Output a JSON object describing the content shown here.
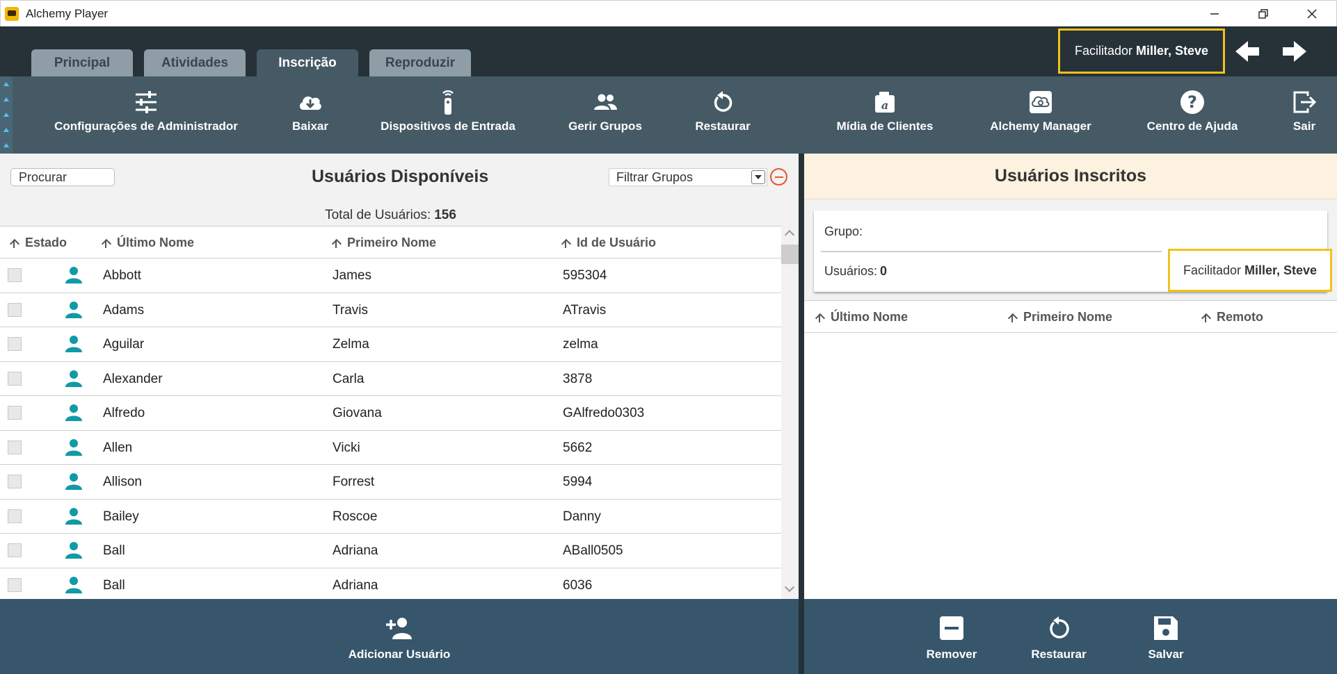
{
  "window": {
    "title": "Alchemy Player",
    "minimize_label": "—",
    "restore_label": "❐",
    "close_label": "✕"
  },
  "tabs": [
    {
      "label": "Principal",
      "active": false
    },
    {
      "label": "Atividades",
      "active": false
    },
    {
      "label": "Inscrição",
      "active": true
    },
    {
      "label": "Reproduzir",
      "active": false
    }
  ],
  "facilitator": {
    "label": "Facilitador",
    "name": "Miller, Steve"
  },
  "toolbar": [
    {
      "label": "Configurações de Administrador",
      "icon": "sliders-icon"
    },
    {
      "label": "Baixar",
      "icon": "cloud-download-icon"
    },
    {
      "label": "Dispositivos de Entrada",
      "icon": "remote-control-icon"
    },
    {
      "label": "Gerir Grupos",
      "icon": "people-icon"
    },
    {
      "label": "Restaurar",
      "icon": "restore-icon"
    },
    {
      "label": "Mídia de Clientes",
      "icon": "media-icon"
    },
    {
      "label": "Alchemy Manager",
      "icon": "cloud-sync-icon"
    },
    {
      "label": "Centro de Ajuda",
      "icon": "help-icon"
    },
    {
      "label": "Sair",
      "icon": "exit-icon"
    }
  ],
  "left": {
    "search_placeholder": "Procurar",
    "title": "Usuários Disponíveis",
    "filter_label": "Filtrar Grupos",
    "total_label": "Total de Usuários:",
    "total_value": "156",
    "columns": [
      "Estado",
      "Último Nome",
      "Primeiro Nome",
      "Id de Usuário"
    ],
    "rows": [
      {
        "last": "Abbott",
        "first": "James",
        "id": "595304"
      },
      {
        "last": "Adams",
        "first": "Travis",
        "id": "ATravis"
      },
      {
        "last": "Aguilar",
        "first": "Zelma",
        "id": "zelma"
      },
      {
        "last": "Alexander",
        "first": "Carla",
        "id": "3878"
      },
      {
        "last": "Alfredo",
        "first": "Giovana",
        "id": "GAlfredo0303"
      },
      {
        "last": "Allen",
        "first": "Vicki",
        "id": "5662"
      },
      {
        "last": "Allison",
        "first": "Forrest",
        "id": "5994"
      },
      {
        "last": "Bailey",
        "first": "Roscoe",
        "id": "Danny"
      },
      {
        "last": "Ball",
        "first": "Adriana",
        "id": "ABall0505"
      },
      {
        "last": "Ball",
        "first": "Adriana",
        "id": "6036"
      }
    ],
    "footer_button": "Adicionar Usuário"
  },
  "right": {
    "title": "Usuários Inscritos",
    "group_label": "Grupo:",
    "users_label": "Usuários:",
    "users_value": "0",
    "columns": [
      "Último Nome",
      "Primeiro Nome",
      "Remoto"
    ],
    "footer_buttons": [
      "Remover",
      "Restaurar",
      "Salvar"
    ]
  },
  "colors": {
    "header_dark": "#263238",
    "toolbar": "#455a64",
    "footer": "#37566c",
    "person_icon": "#0f9aa6",
    "highlight": "#f2c21b",
    "right_header": "#fdf1df"
  }
}
